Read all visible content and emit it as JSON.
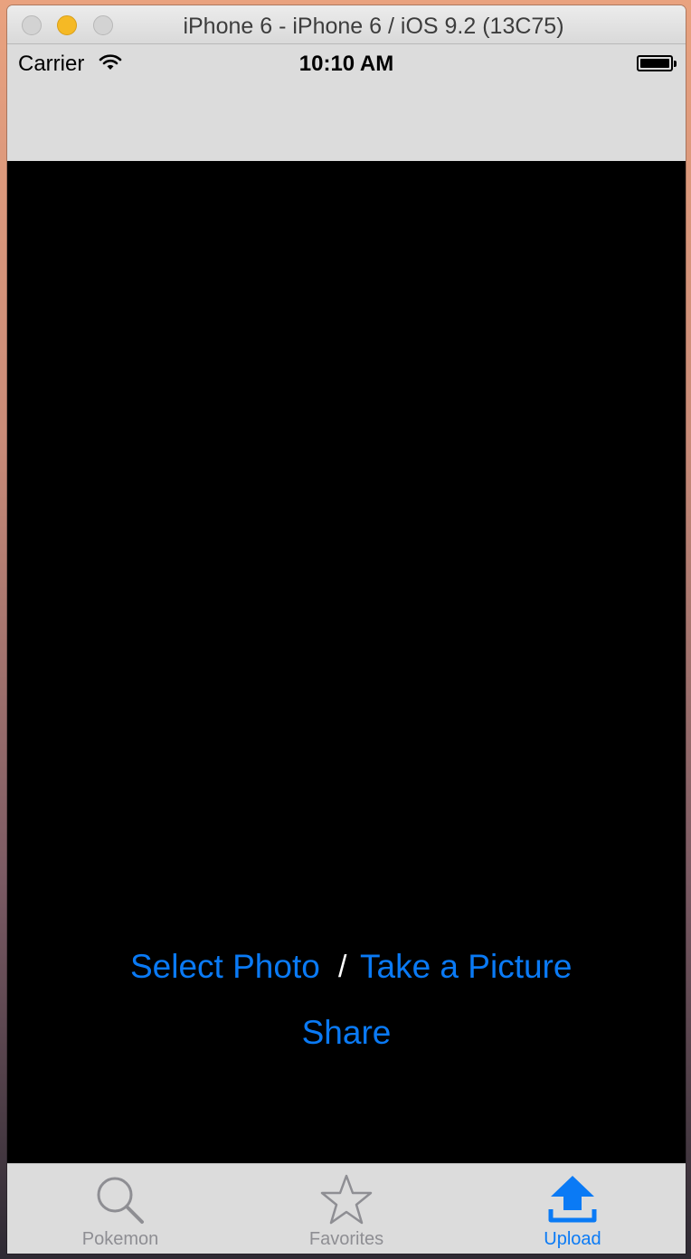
{
  "window": {
    "title": "iPhone 6 - iPhone 6 / iOS 9.2 (13C75)"
  },
  "status_bar": {
    "carrier": "Carrier",
    "time": "10:10 AM",
    "icons": [
      "wifi-icon",
      "battery-icon"
    ]
  },
  "content": {
    "select_photo_label": "Select Photo",
    "separator": "/",
    "take_picture_label": "Take a Picture",
    "share_label": "Share"
  },
  "tab_bar": {
    "items": [
      {
        "label": "Pokemon",
        "icon": "search-icon",
        "active": false
      },
      {
        "label": "Favorites",
        "icon": "star-icon",
        "active": false
      },
      {
        "label": "Upload",
        "icon": "upload-icon",
        "active": true
      }
    ]
  },
  "colors": {
    "accent": "#0a7af5",
    "inactive": "#8e8e93",
    "bar_background": "#dcdcdc",
    "content_background": "#000000"
  }
}
